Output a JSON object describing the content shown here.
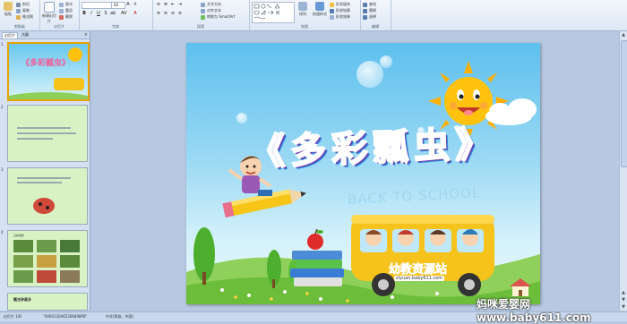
{
  "ribbon": {
    "groups": [
      {
        "id": "clipboard",
        "label": "剪贴板"
      },
      {
        "id": "slides",
        "label": "幻灯片"
      },
      {
        "id": "font",
        "label": "字体"
      },
      {
        "id": "paragraph",
        "label": "段落"
      },
      {
        "id": "drawing",
        "label": "绘图"
      },
      {
        "id": "editing",
        "label": "编辑"
      }
    ],
    "paste_label": "粘贴",
    "cut_label": "剪切",
    "copy_label": "复制",
    "format_painter_label": "格式刷",
    "new_slide_label": "新建幻灯片",
    "layout_label": "版式",
    "reset_label": "重设",
    "delete_label": "删除",
    "font_size_value": "66",
    "text_direction_label": "文字方向",
    "align_text_label": "对齐文本",
    "smartart_label": "转换为 SmartArt",
    "arrange_label": "排列",
    "quick_styles_label": "快速样式",
    "shape_fill_label": "形状填充",
    "shape_outline_label": "形状轮廓",
    "shape_effects_label": "形状效果",
    "find_label": "查找",
    "replace_label": "替换",
    "select_label": "选择"
  },
  "panel": {
    "tabs": [
      {
        "label": "幻灯片"
      },
      {
        "label": "大纲"
      }
    ],
    "close_glyph": "×",
    "slide_numbers": [
      "1",
      "2",
      "3",
      "4"
    ],
    "thumb4_title": "五彩缤纷",
    "thumb5_title": "瓢虫钟最多"
  },
  "slide": {
    "title": "《多彩瓢虫》",
    "back_to_school": "BACK TO SCHOOL",
    "bus_sign": "幼教资源站",
    "bus_url": "ziyuan.baby611.com"
  },
  "statusbar": {
    "slide_info": "幻灯片 1/8",
    "theme": "\"4000120465306898P8\"",
    "language": "中文(简体，中国)"
  },
  "watermark": "妈咪爱婴网 www.baby611.com",
  "colors": {
    "ribbon_bg": "#dde8f5",
    "sun": "#ffc20e",
    "bus": "#f6c21c",
    "selected_border": "#e8a300"
  }
}
